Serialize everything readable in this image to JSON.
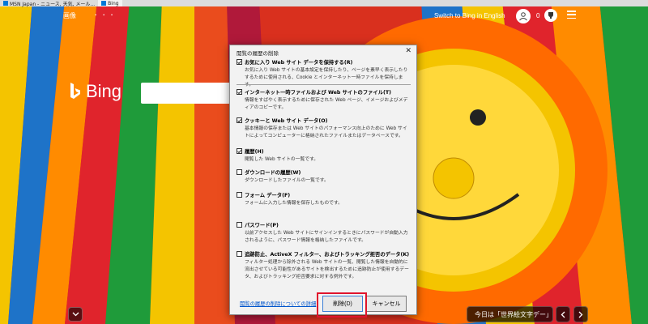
{
  "browser": {
    "tabs": [
      {
        "label": "MSN Japan - ニュース, 天気, メール..."
      },
      {
        "label": "Bing"
      }
    ]
  },
  "bing": {
    "nav": {
      "images": "画像",
      "more": "· · ·"
    },
    "switch_link": "Switch to Bing in English",
    "reward_count": "0",
    "logo_text": "Bing",
    "today_label": "今日は「世界絵文字デー」"
  },
  "dialog": {
    "title": "閲覧の履歴の削除",
    "close": "✕",
    "options": [
      {
        "label": "お気に入り Web サイト データを保持する(R)",
        "desc": "お気に入り Web サイトの基本設定を保持したり、ページを素早く表示したりするために使用される、Cookie とインターネット一時ファイルを保持します。",
        "checked": true
      },
      {
        "label": "インターネット一時ファイルおよび Web サイトのファイル(T)",
        "desc": "情報をすばやく表示するために保存された Web ページ、イメージおよびメディアのコピーです。",
        "checked": true
      },
      {
        "label": "クッキーと Web サイト データ(O)",
        "desc": "基本情報の保存または Web サイトのパフォーマンス向上のために Web サイトによってコンピューターに格納されたファイルまたはデータベースです。",
        "checked": true
      },
      {
        "label": "履歴(H)",
        "desc": "閲覧した Web サイトの一覧です。",
        "checked": true
      },
      {
        "label": "ダウンロードの履歴(W)",
        "desc": "ダウンロードしたファイルの一覧です。",
        "checked": false
      },
      {
        "label": "フォーム データ(F)",
        "desc": "フォームに入力した情報を保存したものです。",
        "checked": false
      },
      {
        "label": "パスワード(P)",
        "desc": "以前アクセスした Web サイトにサインインするときにパスワードが自動入力されるように、パスワード情報を格納したファイルです。",
        "checked": false
      },
      {
        "label": "追跡防止、ActiveX フィルター、およびトラッキング拒否のデータ(K)",
        "desc": "フィルター処理から除外される Web サイトの一覧、閲覧した情報を自動的に流出させている可能性があるサイトを検出するために追跡防止が使用するデータ、およびトラッキング拒否要求に対する例外です。",
        "checked": false
      }
    ],
    "more_link": "閲覧の履歴の削除についての詳細",
    "delete_button": "削除(D)",
    "cancel_button": "キャンセル"
  },
  "colors": {
    "dialog_bg": "#f2f2f2",
    "link": "#0055cc",
    "highlight": "#e0142c"
  }
}
